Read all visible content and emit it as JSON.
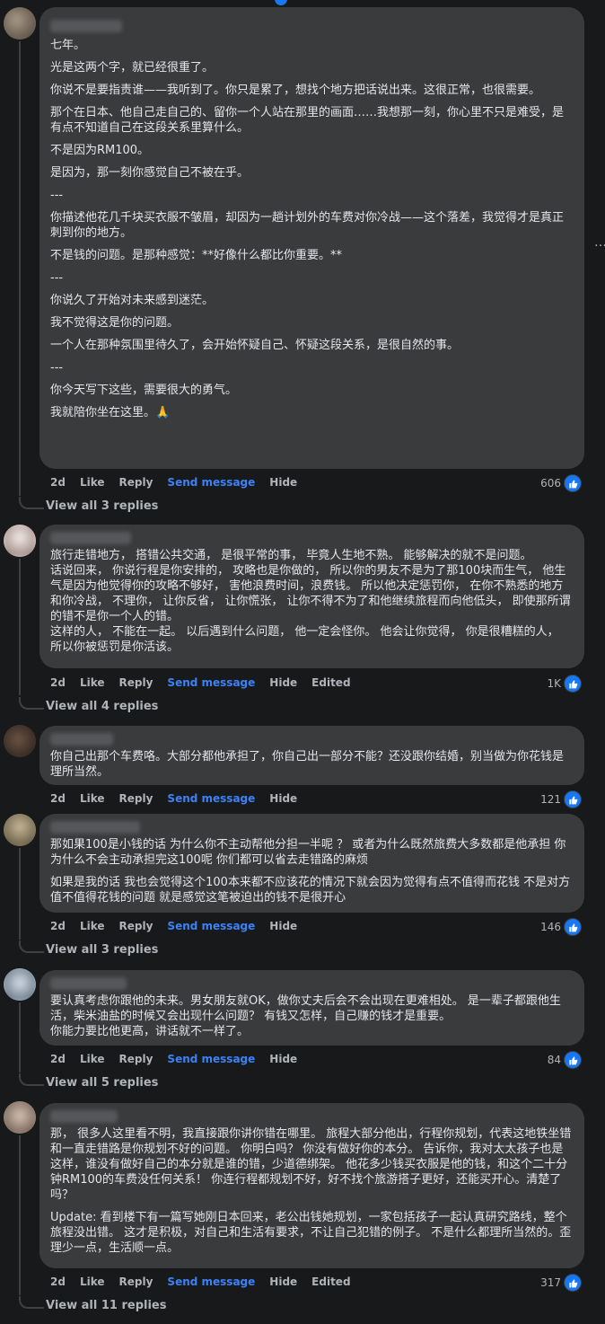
{
  "comments": [
    {
      "paragraphs": [
        "七年。",
        "光是这两个字，就已经很重了。",
        "你说不是要指责谁——我听到了。你只是累了，想找个地方把话说出来。这很正常，也很需要。",
        "那个在日本、他自己走自己的、留你一个人站在那里的画面……我想那一刻，你心里不只是难受，是有点不知道自己在这段关系里算什么。",
        "不是因为RM100。",
        "是因为，那一刻你感觉自己不被在乎。",
        "---",
        "你描述他花几千块买衣服不皱眉，却因为一趟计划外的车费对你冷战——这个落差，我觉得才是真正刺到你的地方。",
        "不是钱的问题。是那种感觉：**好像什么都比你重要。**",
        "---",
        "你说久了开始对未来感到迷茫。",
        "我不觉得这是你的问题。",
        "一个人在那种氛围里待久了，会开始怀疑自己、怀疑这段关系，是很自然的事。",
        "---",
        "你今天写下这些，需要很大的勇气。",
        "我就陪你坐在这里。🙏"
      ],
      "time": "2d",
      "like": "Like",
      "reply": "Reply",
      "send": "Send message",
      "hide": "Hide",
      "edited": "",
      "reactions": "606",
      "view_replies": "View all 3 replies"
    },
    {
      "paragraphs": [
        "旅行走错地方， 搭错公共交通， 是很平常的事， 毕竟人生地不熟。 能够解决的就不是问题。\n话说回来， 你说行程是你安排的， 攻略也是你做的， 所以你的男友不是为了那100块而生气， 他生气是因为他觉得你的攻略不够好， 害他浪费时间，浪费钱。 所以他决定惩罚你， 在你不熟悉的地方和你冷战， 不理你， 让你反省， 让你慌张， 让你不得不为了和他继续旅程而向他低头， 即使那所谓的错不是你一个人的错。\n这样的人， 不能在一起。 以后遇到什么问题， 他一定会怪你。 他会让你觉得， 你是很糟糕的人， 所以你被惩罚是你活该。"
      ],
      "time": "2d",
      "like": "Like",
      "reply": "Reply",
      "send": "Send message",
      "hide": "Hide",
      "edited": "Edited",
      "reactions": "1K",
      "view_replies": "View all 4 replies"
    },
    {
      "paragraphs": [
        "你自己出那个车费咯。大部分都他承担了，你自己出一部分不能？还没跟你结婚，别当做为你花钱是理所当然。"
      ],
      "time": "2d",
      "like": "Like",
      "reply": "Reply",
      "send": "Send message",
      "hide": "Hide",
      "edited": "",
      "reactions": "121",
      "view_replies": ""
    },
    {
      "paragraphs": [
        "那如果100是小钱的话 为什么你不主动帮他分担一半呢 ？ 或者为什么既然旅费大多数都是他承担 你为什么不会主动承担完这100呢 你们都可以省去走错路的麻烦",
        "如果是我的话 我也会觉得这个100本来都不应该花的情况下就会因为觉得有点不值得而花钱 不是对方值不值得花钱的问题 就是感觉这笔被迫出的钱不是很开心"
      ],
      "time": "2d",
      "like": "Like",
      "reply": "Reply",
      "send": "Send message",
      "hide": "Hide",
      "edited": "",
      "reactions": "146",
      "view_replies": "View all 3 replies"
    },
    {
      "paragraphs": [
        "要认真考虑你跟他的未来。男女朋友就OK，做你丈夫后会不会出现在更难相处。 是一辈子都跟他生活，柴米油盐的时候又会出现什么问题？ 有钱又怎样，自己赚的钱才是重要。\n你能力要比他更高，讲话就不一样了。"
      ],
      "time": "2d",
      "like": "Like",
      "reply": "Reply",
      "send": "Send message",
      "hide": "Hide",
      "edited": "",
      "reactions": "84",
      "view_replies": "View all 5 replies"
    },
    {
      "paragraphs": [
        "那， 很多人这里看不明，我直接跟你讲你错在哪里。 旅程大部分他出，行程你规划，代表这地铁坐错和一直走错路是你规划不好的问题。 你明白吗？ 你没有做好你的本分。 告诉你，我对太太孩子也是这样，谁没有做好自己的本分就是谁的错，少道德绑架。 他花多少钱买衣服是他的钱，和这个二十分钟RM100的车费没任何关系！ 你连行程都规划不好，好不找个旅游搭子更好，还能买开心。清楚了吗？",
        "Update: 看到楼下有一篇写她刚日本回来，老公出钱她规划，一家包括孩子一起认真研究路线，整个旅程没出错。 这才是积极，对自己和生活有要求，不让自己犯错的例子。 不是什么都理所当然的。歪理少一点，生活顺一点。"
      ],
      "time": "2d",
      "like": "Like",
      "reply": "Reply",
      "send": "Send message",
      "hide": "Hide",
      "edited": "Edited",
      "reactions": "317",
      "view_replies": "View all 11 replies"
    }
  ],
  "more_icon": "…",
  "colors": {
    "link": "#3b82f6",
    "like_badge": "#1877f2",
    "bubble": "#3a3b3c"
  }
}
